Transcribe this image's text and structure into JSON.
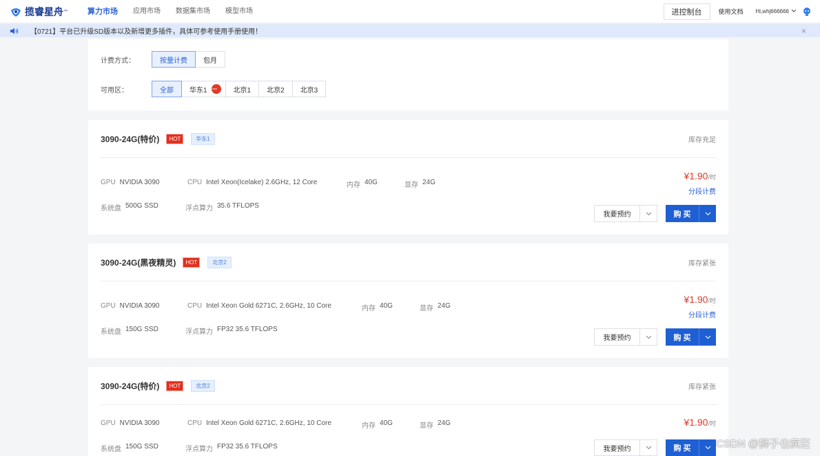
{
  "nav": {
    "logo_text": "揽睿星舟",
    "logo_tm": "™",
    "items": [
      "算力市场",
      "应用市场",
      "数据集市场",
      "模型市场"
    ],
    "console_label": "进控制台",
    "docs_label": "使用文档",
    "user_name": "Hi,whj666666",
    "colors": {
      "accent": "#2b63d9",
      "brand": "#1a3a8f"
    }
  },
  "notice": {
    "text": "【0721】平台已升级SD版本以及新增更多插件，具体可参考使用手册使用！",
    "close_icon": "×"
  },
  "filters": {
    "billing_label": "计费方式：",
    "billing_options": [
      "按量计费",
      "包月"
    ],
    "billing_selected": "按量计费",
    "region_label": "可用区：",
    "region_options": [
      "全部",
      "华东1",
      "北京1",
      "北京2",
      "北京3"
    ],
    "region_selected": "全部"
  },
  "products": [
    {
      "title": "3090-24G(特价)",
      "hot": "HOT",
      "region": "华东1",
      "stock": "库存充足",
      "gpu_label": "GPU",
      "gpu": "NVIDIA 3090",
      "cpu_label": "CPU",
      "cpu": "Intel Xeon(Icelake) 2.6GHz, 12 Core",
      "mem_label": "内存",
      "mem": "40G",
      "vram_label": "显存",
      "vram": "24G",
      "disk_label": "系统盘",
      "disk": "500G SSD",
      "flops_label": "浮点算力",
      "flops": "35.6 TFLOPS",
      "price": "¥1.90",
      "price_unit": "/时",
      "tier_label": "分段计费",
      "reserve_label": "我要预约",
      "buy_label": "购 买"
    },
    {
      "title": "3090-24G(黑夜精灵)",
      "hot": "HOT",
      "region": "北京2",
      "stock": "库存紧张",
      "gpu_label": "GPU",
      "gpu": "NVIDIA 3090",
      "cpu_label": "CPU",
      "cpu": "Intel Xeon Gold 6271C, 2.6GHz, 10 Core",
      "mem_label": "内存",
      "mem": "40G",
      "vram_label": "显存",
      "vram": "24G",
      "disk_label": "系统盘",
      "disk": "150G SSD",
      "flops_label": "浮点算力",
      "flops": "FP32 35.6 TFLOPS",
      "price": "¥1.90",
      "price_unit": "/时",
      "tier_label": "分段计费",
      "reserve_label": "我要预约",
      "buy_label": "购 买"
    },
    {
      "title": "3090-24G(特价)",
      "hot": "HOT",
      "region": "北京2",
      "stock": "库存紧张",
      "gpu_label": "GPU",
      "gpu": "NVIDIA 3090",
      "cpu_label": "CPU",
      "cpu": "Intel Xeon Gold 6271C, 2.6GHz, 10 Core",
      "mem_label": "内存",
      "mem": "40G",
      "vram_label": "显存",
      "vram": "24G",
      "disk_label": "系统盘",
      "disk": "150G SSD",
      "flops_label": "浮点算力",
      "flops": "FP32 35.6 TFLOPS",
      "price": "¥1.90",
      "price_unit": "/时",
      "reserve_label": "我要预约",
      "buy_label": "购 买"
    }
  ],
  "watermark": "CSDN @狮子也疯狂"
}
